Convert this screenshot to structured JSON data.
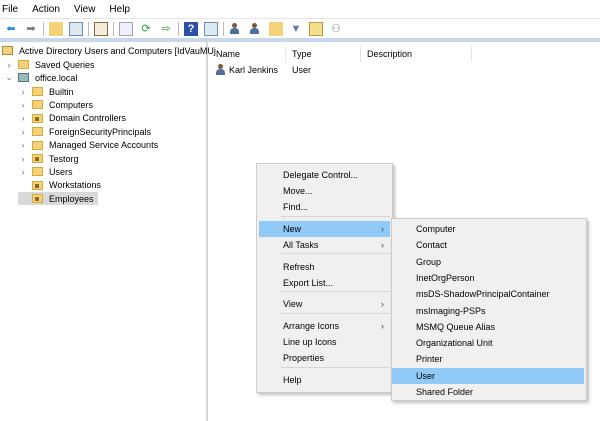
{
  "menubar": [
    "File",
    "Action",
    "View",
    "Help"
  ],
  "toolbar": [
    "back-icon",
    "forward-icon",
    "up-folder-icon",
    "show-tree-icon",
    "clipboard-icon",
    "export-icon",
    "refresh-icon",
    "export-list-icon",
    "help-icon",
    "console-icon",
    "new-user-icon",
    "new-group-icon",
    "new-ou-icon",
    "filter-icon",
    "find-icon",
    "delegate-icon"
  ],
  "tree": {
    "root": "Active Directory Users and Computers [IdVauMUj",
    "saved_queries": "Saved Queries",
    "domain": "office.local",
    "children": [
      {
        "label": "Builtin",
        "ou": false,
        "expandable": true
      },
      {
        "label": "Computers",
        "ou": false,
        "expandable": true
      },
      {
        "label": "Domain Controllers",
        "ou": true,
        "expandable": true
      },
      {
        "label": "ForeignSecurityPrincipals",
        "ou": false,
        "expandable": true
      },
      {
        "label": "Managed Service Accounts",
        "ou": false,
        "expandable": true
      },
      {
        "label": "Testorg",
        "ou": true,
        "expandable": true
      },
      {
        "label": "Users",
        "ou": false,
        "expandable": true
      },
      {
        "label": "Workstations",
        "ou": true,
        "expandable": false
      },
      {
        "label": "Employees",
        "ou": true,
        "expandable": false,
        "selected": true
      }
    ]
  },
  "list": {
    "columns": [
      "Name",
      "Type",
      "Description"
    ],
    "rows": [
      {
        "name": "Karl Jenkins",
        "type": "User",
        "description": ""
      }
    ]
  },
  "context_menu": {
    "items": [
      "Delegate Control...",
      "Move...",
      "Find...",
      "New",
      "All Tasks",
      "Refresh",
      "Export List...",
      "View",
      "Arrange Icons",
      "Line up Icons",
      "Properties",
      "Help"
    ],
    "highlighted": "New"
  },
  "submenu": {
    "items": [
      "Computer",
      "Contact",
      "Group",
      "InetOrgPerson",
      "msDS-ShadowPrincipalContainer",
      "msImaging-PSPs",
      "MSMQ Queue Alias",
      "Organizational Unit",
      "Printer",
      "User",
      "Shared Folder"
    ],
    "highlighted": "User"
  },
  "colors": {
    "highlight": "#91c9f7",
    "selected": "#d9d9d9",
    "accent_line": "#c7d8eb"
  }
}
